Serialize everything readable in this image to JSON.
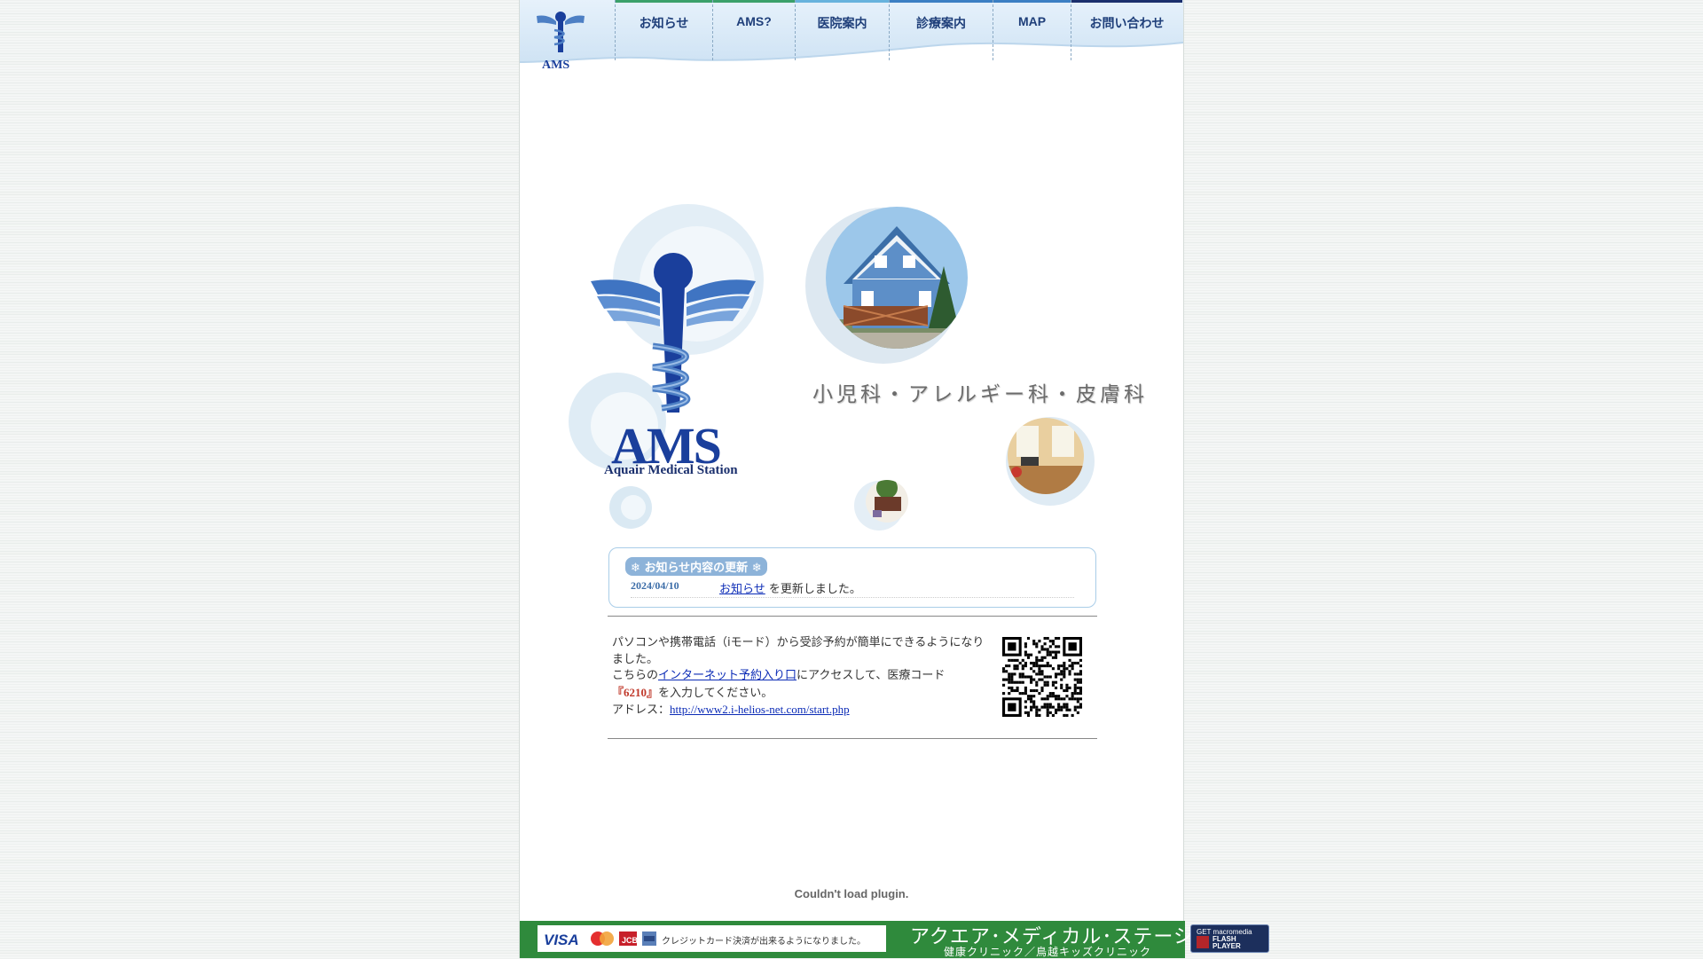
{
  "nav": {
    "items": [
      {
        "label": "お知らせ",
        "color": "#3aa06a"
      },
      {
        "label": "AMS?",
        "color": "#3aa06a"
      },
      {
        "label": "医院案内",
        "color": "#67b3dd"
      },
      {
        "label": "診療案内",
        "color": "#3b7fc3"
      },
      {
        "label": "MAP",
        "color": "#3b7fc3"
      },
      {
        "label": "お問い合わせ",
        "color": "#1a2f6d"
      }
    ]
  },
  "hero": {
    "logo_text": "AMS",
    "logo_caption": "Aquair Medical Station",
    "tagline": "小児科・アレルギー科・皮膚科"
  },
  "news": {
    "heading": "お知らせ内容の更新",
    "entries": [
      {
        "date": "2024/04/10",
        "link": "お知らせ",
        "text": "を更新しました。"
      }
    ]
  },
  "reservation": {
    "line1": "パソコンや携帯電話（iモード）から受診予約が簡単にできるようになりました。",
    "line2_prefix": "こちらの",
    "line2_link": "インターネット予約入り口",
    "line2_suffix": "にアクセスして、医療コード",
    "code": "『6210』",
    "line3_suffix": "を入力してください。",
    "address_label": "アドレス：",
    "address_url": "http://www2.i-helios-net.com/start.php"
  },
  "plugin_message": "Couldn't load plugin.",
  "footer": {
    "card_logos": [
      "VISA",
      "MasterCard",
      "JCB",
      "AMEX"
    ],
    "card_text": "クレジットカード決済が出来るようになりました。",
    "title": "アクエア･メディカル･ステーション",
    "subtitle": "健康クリニック／鳥越キッズクリニック",
    "flash_badge": {
      "line1": "GET macromedia",
      "line2": "FLASH",
      "line3": "PLAYER"
    }
  },
  "colors": {
    "nav_text": "#1f3f7a",
    "footer_bg": "#2f8a3c",
    "logo_blue": "#1a3f9c"
  }
}
